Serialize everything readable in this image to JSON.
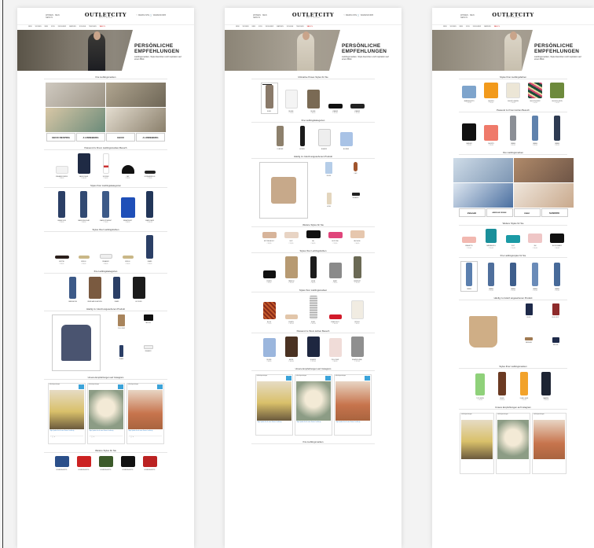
{
  "header": {
    "logo": "OUTLETCITY",
    "logo_sub": "METZINGEN",
    "left_links": [
      "WOMEN · MEN",
      "NEW IN"
    ],
    "right_links": "♡ MERKLISTE  🛒 WARENKORB"
  },
  "nav": [
    "NEW",
    "WOMEN",
    "MEN",
    "KIDS",
    "DESIGNER",
    "MARKEN",
    "SCHUHE",
    "TASCHEN",
    "SPORT",
    "LIFESTYLE",
    "HOME"
  ],
  "nav_sale": "SALE %",
  "hero": {
    "title": "PERSÖNLICHE EMPFEHLUNGEN",
    "text": "Lieblingsmarken, Style-Favoriten und Inspiration auf einen Blick"
  },
  "page1": {
    "sec_brands": "Ihre Lieblingsmarken",
    "brand_logos": [
      "GEOX RESPIRA",
      "J.LINDEBERG",
      "GEOX",
      "J.LINDEBERG"
    ],
    "sec_passend": "Passend zu Ihrem Lieblingsmarken-Besuch",
    "row1": [
      {
        "lbl": "SNEAKER WEISS",
        "price": "€ 89,95"
      },
      {
        "lbl": "SAKKO BLAU",
        "price": "€ 149,95"
      },
      {
        "lbl": "SOCKEN",
        "price": "€ 14,95"
      },
      {
        "lbl": "CAP",
        "price": "€ 29,95"
      },
      {
        "lbl": "SONNENBRILLE",
        "price": "€ 79,95"
      }
    ],
    "sec_kategorien": "Styles Ihrer Lieblingskategorien",
    "row2": [
      {
        "lbl": "JEANS SLIM",
        "price": "€ 99,95"
      },
      {
        "lbl": "JEANS REGULAR",
        "price": "€ 89,95"
      },
      {
        "lbl": "JEANS STRAIGHT",
        "price": "€ 79,95"
      },
      {
        "lbl": "SWEATSHIRT",
        "price": "€ 69,95"
      },
      {
        "lbl": "JEANS DARK",
        "price": "€ 109,95"
      }
    ],
    "sec_styles": "Styles Ihrer Lieblingsfarben",
    "row3": [
      {
        "lbl": "GÜRTEL",
        "price": "€ 39,95"
      },
      {
        "lbl": "BRILLE",
        "price": "€ 59,95"
      },
      {
        "lbl": "SNEAKER",
        "price": "€ 89,95"
      },
      {
        "lbl": "BRILLE",
        "price": "€ 59,95"
      },
      {
        "lbl": "JEANS",
        "price": "€ 99,95"
      }
    ],
    "sec_cats": "Ihre Lieblingskategorien",
    "row4": [
      {
        "lbl": "JEANSHOSE",
        "price": ""
      },
      {
        "lbl": "ÜBERGANGSJACKEN",
        "price": ""
      },
      {
        "lbl": "JEANS",
        "price": ""
      },
      {
        "lbl": "HOODIES",
        "price": ""
      }
    ],
    "sec_recent": "Häufig zu zuletzt angesehenen Produkt",
    "minis": [
      {
        "lbl": "PULLOVER"
      },
      {
        "lbl": "TASCHE"
      },
      {
        "lbl": "JEANS"
      },
      {
        "lbl": "SNEAKER"
      }
    ],
    "sec_insta": "Unsere Empfehlungen auf Instagram",
    "insta_user": "outletcitymetzingen",
    "insta_btn": "Folgen",
    "insta_caption": "Style Update für die neue Saison #outletcity",
    "sec_more": "Weitere Styles für Sie",
    "row5": [
      {
        "lbl": "BOXERSHORTS",
        "price": "€ 29,95"
      },
      {
        "lbl": "BOXERSHORTS",
        "price": "€ 29,95"
      },
      {
        "lbl": "BOXERSHORTS",
        "price": "€ 29,95"
      },
      {
        "lbl": "BOXERSHORTS",
        "price": "€ 29,95"
      },
      {
        "lbl": "BOXERSHORTS",
        "price": "€ 29,95"
      }
    ]
  },
  "page2": {
    "sec1": "Ultimative Power-Styles für Sie",
    "badge": "BESTSELLER",
    "row1": [
      {
        "lbl": "KLEID",
        "price": "€ 129,95"
      },
      {
        "lbl": "BLUSE",
        "price": "€ 79,95"
      },
      {
        "lbl": "BLUSE",
        "price": "€ 89,95"
      },
      {
        "lbl": "LOAFER",
        "price": "€ 119,95"
      },
      {
        "lbl": "LOAFER",
        "price": "€ 119,95"
      }
    ],
    "sec2": "Ihre Lieblingskategorien",
    "row2": [
      {
        "lbl": "KLEIDER",
        "price": ""
      },
      {
        "lbl": "HOSEN",
        "price": ""
      },
      {
        "lbl": "BLAZER",
        "price": ""
      },
      {
        "lbl": "BLUSEN",
        "price": ""
      }
    ],
    "sec3": "Häufig zu zuletzt angesehenen Produkt",
    "minis": [
      {
        "lbl": "BLUSE"
      },
      {
        "lbl": "UHR"
      },
      {
        "lbl": "HOSE"
      },
      {
        "lbl": "SNEAKER"
      }
    ],
    "sec4": "Weitere Styles für Sie",
    "row4": [
      {
        "lbl": "SPITZEN-BODY",
        "price": "€ 39,95"
      },
      {
        "lbl": "SLIP",
        "price": "€ 19,95"
      },
      {
        "lbl": "BH",
        "price": "€ 44,95"
      },
      {
        "lbl": "SLIP PINK",
        "price": "€ 19,95"
      },
      {
        "lbl": "BH NUDE",
        "price": "€ 44,95"
      }
    ],
    "sec5": "Styles Ihrer Lieblingsfarben",
    "row5": [
      {
        "lbl": "PUMPS",
        "price": "€ 99,95"
      },
      {
        "lbl": "TRENCH",
        "price": "€ 199,95"
      },
      {
        "lbl": "HOSE",
        "price": "€ 89,95"
      },
      {
        "lbl": "SHIRT",
        "price": "€ 49,95"
      },
      {
        "lbl": "JUMPSUIT",
        "price": "€ 119,95"
      }
    ],
    "sec6": "Styles Ihrer Lieblingsmarken",
    "row6": [
      {
        "lbl": "ROCK",
        "price": "€ 79,95"
      },
      {
        "lbl": "PUMPS",
        "price": "€ 109,95"
      },
      {
        "lbl": "KLEID",
        "price": "€ 149,95"
      },
      {
        "lbl": "PUMPS ROT",
        "price": "€ 109,95"
      },
      {
        "lbl": "STRICK",
        "price": "€ 89,95"
      }
    ],
    "sec7": "Passend zu Ihrem letzten Besuch",
    "row7": [
      {
        "lbl": "BLUSE",
        "price": "€ 69,95"
      },
      {
        "lbl": "JACKE",
        "price": "€ 149,95"
      },
      {
        "lbl": "BLAZER",
        "price": "€ 179,95"
      },
      {
        "lbl": "PULLOVER",
        "price": "€ 89,95"
      },
      {
        "lbl": "BLAZER GRAU",
        "price": "€ 179,95"
      }
    ],
    "sec8": "Unsere Empfehlungen auf Instagram",
    "sec9": "Ihre Lieblingsmarken"
  },
  "page3": {
    "sec1": "Styles Ihrer Lieblingsfarben",
    "row1": [
      {
        "lbl": "JEANSSHORTS",
        "price": "€ 49,95"
      },
      {
        "lbl": "SHORTS",
        "price": "€ 39,95"
      },
      {
        "lbl": "SHORTS WEISS",
        "price": "€ 39,95"
      },
      {
        "lbl": "SHORTS PRINT",
        "price": "€ 44,95"
      },
      {
        "lbl": "SHORTS GRÜN",
        "price": "€ 39,95"
      }
    ],
    "sec2": "Passend zu Ihrem letzten Besuch",
    "row2": [
      {
        "lbl": "RADLER",
        "price": "€ 29,95"
      },
      {
        "lbl": "SHORTS",
        "price": "€ 39,95"
      },
      {
        "lbl": "JEANS",
        "price": "€ 89,95"
      },
      {
        "lbl": "JEANS",
        "price": "€ 89,95"
      },
      {
        "lbl": "JEANS",
        "price": "€ 89,95"
      }
    ],
    "sec3": "Ihre Lieblingsmarken",
    "brand_logos": [
      "Zalando",
      "mavi",
      "SANDRO",
      "mavi"
    ],
    "logos_row": [
      "Zalando",
      "AMERICAN VINTAGE",
      "mavi",
      "SANDRO"
    ],
    "sec4": "Weitere Styles für Sie",
    "row4": [
      {
        "lbl": "BRALETTE",
        "price": "€ 29,95"
      },
      {
        "lbl": "BADEANZUG",
        "price": "€ 59,95"
      },
      {
        "lbl": "SLIP",
        "price": "€ 19,95"
      },
      {
        "lbl": "BH",
        "price": "€ 39,95"
      },
      {
        "lbl": "BH SCHWARZ",
        "price": "€ 39,95"
      }
    ],
    "sec5": "Ihre Lieblingsstyles für Sie",
    "row5": [
      {
        "lbl": "JEANS",
        "price": ""
      },
      {
        "lbl": "JEANS",
        "price": "€ 99,95"
      },
      {
        "lbl": "JEANS",
        "price": "€ 99,95"
      },
      {
        "lbl": "JEANS",
        "price": "€ 99,95"
      },
      {
        "lbl": "JEANS",
        "price": "€ 99,95"
      }
    ],
    "sec6": "Häufig zu zuletzt angesehenen Produkt",
    "minis": [
      {
        "lbl": "KLEID"
      },
      {
        "lbl": "KLEID ROT"
      },
      {
        "lbl": "SANDALE"
      },
      {
        "lbl": "TASCHE"
      }
    ],
    "sec7": "Styles Ihrer Lieblingsmarken",
    "row7": [
      {
        "lbl": "TOP GRÜN",
        "price": "€ 39,95"
      },
      {
        "lbl": "KLEID",
        "price": "€ 129,95"
      },
      {
        "lbl": "KLEID GELB",
        "price": "€ 99,95"
      },
      {
        "lbl": "MANTEL",
        "price": "€ 249,95"
      }
    ],
    "sec8": "Unsere Empfehlungen auf Instagram"
  },
  "colors": {
    "accent": "#3ba3d9",
    "sale": "#cc0000"
  }
}
